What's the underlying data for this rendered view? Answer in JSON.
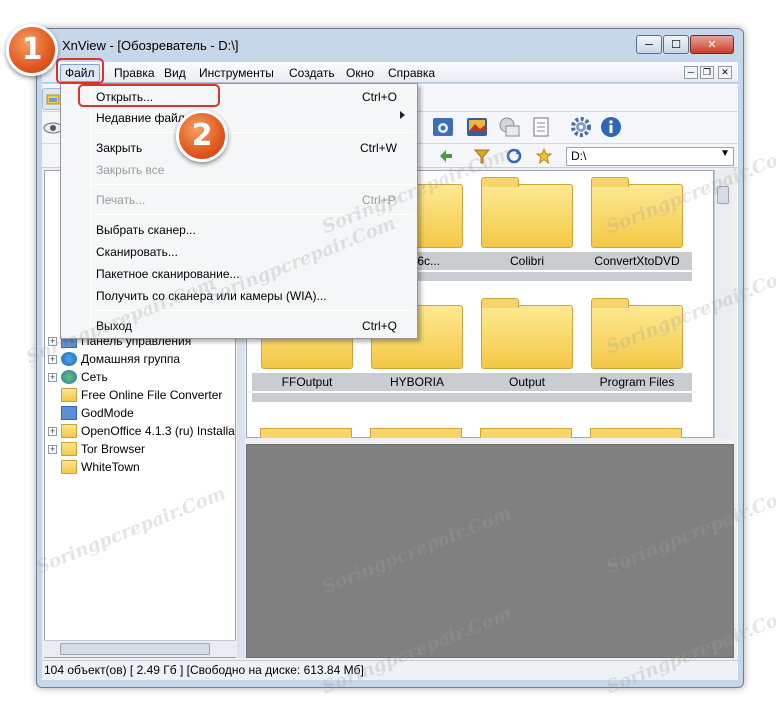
{
  "window": {
    "title": "XnView - [Обозреватель - D:\\]",
    "min_label": "─",
    "max_label": "☐",
    "close_label": "✕"
  },
  "menubar": {
    "items": [
      "Файл",
      "Правка",
      "Вид",
      "Инструменты",
      "Создать",
      "Окно",
      "Справка"
    ],
    "mdi_min": "─",
    "mdi_restore": "❐",
    "mdi_close": "✕"
  },
  "file_menu": {
    "items": [
      {
        "label": "Открыть...",
        "shortcut": "Ctrl+O",
        "enabled": true
      },
      {
        "label": "Недавние файлы",
        "shortcut": "",
        "enabled": true,
        "submenu": true
      },
      {
        "label": "Закрыть",
        "shortcut": "Ctrl+W",
        "enabled": true
      },
      {
        "label": "Закрыть все",
        "shortcut": "",
        "enabled": false
      },
      {
        "label": "Печать...",
        "shortcut": "Ctrl+P",
        "enabled": false
      },
      {
        "label": "Выбрать сканер...",
        "shortcut": "",
        "enabled": true
      },
      {
        "label": "Сканировать...",
        "shortcut": "",
        "enabled": true
      },
      {
        "label": "Пакетное сканирование...",
        "shortcut": "",
        "enabled": true
      },
      {
        "label": "Получить со сканера или камеры (WIA)...",
        "shortcut": "",
        "enabled": true
      },
      {
        "label": "Выход",
        "shortcut": "Ctrl+Q",
        "enabled": true
      }
    ]
  },
  "address": {
    "path": "D:\\"
  },
  "tree": {
    "items": [
      {
        "label": "Панель управления",
        "icon": "control-panel-icon"
      },
      {
        "label": "Домашняя группа",
        "icon": "homegroup-icon"
      },
      {
        "label": "Сеть",
        "icon": "network-icon"
      },
      {
        "label": "Free Online File Converter",
        "icon": "folder-icon"
      },
      {
        "label": "GodMode",
        "icon": "godmode-icon"
      },
      {
        "label": "OpenOffice 4.1.3 (ru) Installa",
        "icon": "folder-icon"
      },
      {
        "label": "Tor Browser",
        "icon": "folder-icon"
      },
      {
        "label": "WhiteTown",
        "icon": "folder-icon"
      }
    ]
  },
  "thumbnails": {
    "row1": [
      "f9d56c...",
      "Colibri",
      "ConvertXtoDVD"
    ],
    "row2": [
      "FFOutput",
      "HYBORIA",
      "Output",
      "Program Files"
    ]
  },
  "status": {
    "text": "104 объект(ов) [ 2.49 Гб ] [Свободно на диске: 613.84 Мб]"
  },
  "callouts": {
    "step1": "1",
    "step2": "2"
  },
  "watermark": {
    "text": "Soringpcrepair.Com"
  },
  "colors": {
    "callout": "#e1581f",
    "highlight_border": "#d9352a",
    "preview_bg": "#808080"
  }
}
